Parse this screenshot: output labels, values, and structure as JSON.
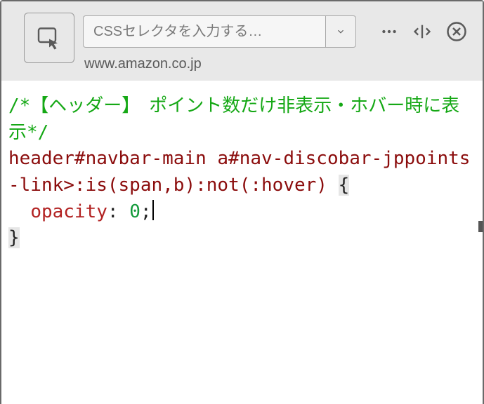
{
  "toolbar": {
    "selector_placeholder": "CSSセレクタを入力する…",
    "domain": "www.amazon.co.jp"
  },
  "icons": {
    "picker": "element-picker-icon",
    "dropdown": "chevron-down-icon",
    "more": "more-horizontal-icon",
    "dock": "dock-side-icon",
    "close": "close-icon"
  },
  "code": {
    "comment": "/*【ヘッダー】　ポイント数だけ非表示・ホバー時に表示*/",
    "selector": "header#navbar-main a#nav-discobar-jppoints-link>:is(span,b):not(:hover)",
    "brace_open": "{",
    "property": "opacity",
    "colon": ": ",
    "value": "0",
    "semicolon": ";",
    "brace_close": "}"
  }
}
